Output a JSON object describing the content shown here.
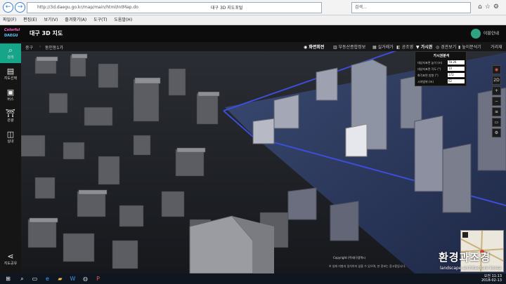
{
  "browser": {
    "url": "http://3d.daegu.go.kr/map/main/html/IntMap.do",
    "tab_title": "대구 3D 지도포털",
    "search_placeholder": "검색..."
  },
  "menu": [
    "파일(F)",
    "편집(E)",
    "보기(V)",
    "즐겨찾기(A)",
    "도구(T)",
    "도움말(H)"
  ],
  "app": {
    "logo_line1": "Colorful",
    "logo_line2": "DAEGU",
    "title": "대구 3D 지도",
    "user_label": "이용안내"
  },
  "sidebar": [
    {
      "label": "검색",
      "icon": "search-icon"
    },
    {
      "label": "지도선택",
      "icon": "map-select-icon"
    },
    {
      "label": "버스",
      "icon": "bus-icon"
    },
    {
      "label": "관광",
      "icon": "tourism-icon"
    },
    {
      "label": "실내",
      "icon": "indoor-icon"
    },
    {
      "label": "지도공유",
      "icon": "share-icon"
    }
  ],
  "toolbar": {
    "district": "중구",
    "dong": "동인동1가",
    "rotate": "화면회전",
    "buttons": [
      "부동산종합정보",
      "실거래가",
      "공조영",
      "가시권",
      "경관보기",
      "높이분석기",
      "거리재"
    ]
  },
  "visibility_panel": {
    "title": "가시권분석",
    "rows": [
      {
        "label": "대상지표면 높이 (m)",
        "value": "78.26"
      },
      {
        "label": "대상지표면 각도 (°)",
        "value": "10"
      },
      {
        "label": "화각표면 방향 (°)",
        "value": "172"
      },
      {
        "label": "시야범위 (m)",
        "value": "62"
      }
    ]
  },
  "right_tools": [
    "compass-icon",
    "2D",
    "zoom-in-icon",
    "zoom-out-icon",
    "layer-icon",
    "street-view-icon",
    "settings-icon"
  ],
  "map": {
    "copyright": "Copyright (주)대구광역시",
    "notice": "※ 실제 지형과 일치하지 않을 수 있으며, 본 정보는 참고용입니다."
  },
  "watermark": {
    "main": "환경과조경",
    "sub": "landscape architecture korea"
  },
  "taskbar": {
    "time": "오전 11:13",
    "date": "2018-02-13"
  },
  "colors": {
    "accent": "#17a589",
    "view_cone": "#3c4ed8"
  }
}
